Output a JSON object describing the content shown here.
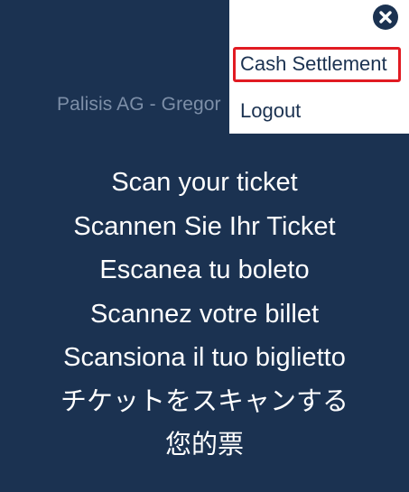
{
  "company_label": "Palisis AG - Gregor",
  "scan_messages": [
    "Scan your ticket",
    "Scannen Sie Ihr Ticket",
    "Escanea tu boleto",
    "Scannez votre billet",
    "Scansiona il tuo biglietto",
    "チケットをスキャンする",
    "您的票"
  ],
  "menu": {
    "close_icon": "close-x-circle-icon",
    "items": [
      {
        "label": "Cash Settlement"
      },
      {
        "label": "Logout"
      }
    ]
  },
  "colors": {
    "background": "#1b3251",
    "menu_background": "#ffffff",
    "highlight": "#e11b22",
    "company_label": "#7d8fa8"
  }
}
